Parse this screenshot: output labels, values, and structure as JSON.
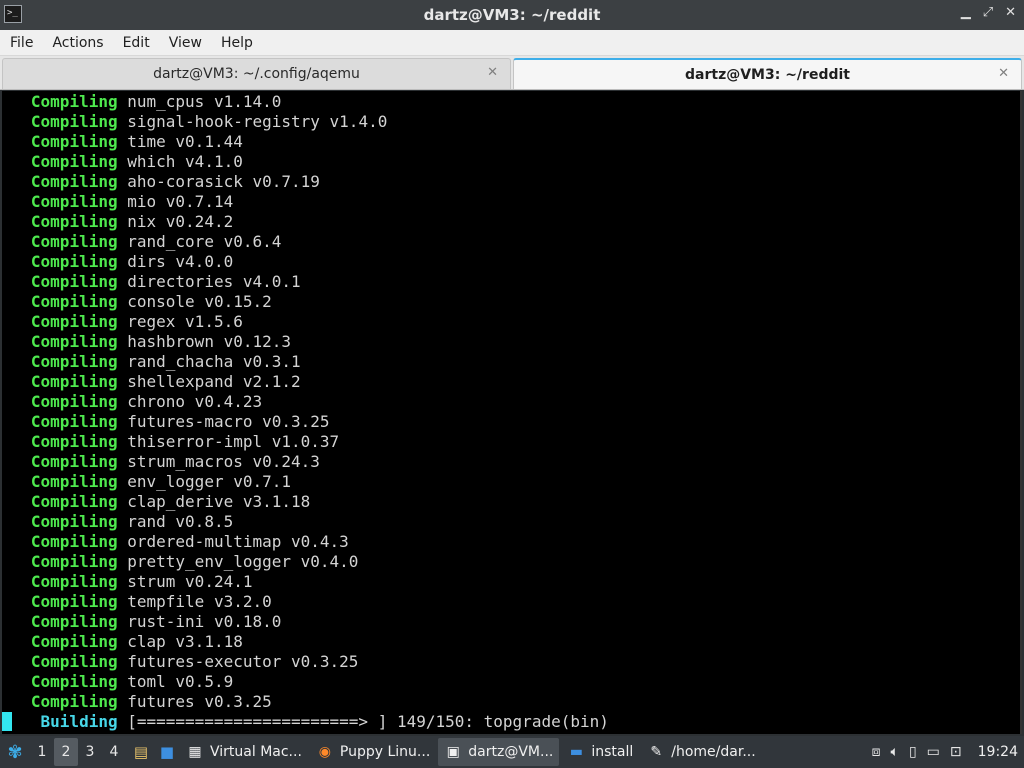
{
  "window": {
    "title": "dartz@VM3: ~/reddit",
    "minimize_glyph": "▁",
    "maximize_glyph": "⤢",
    "close_glyph": "✕"
  },
  "menu": [
    "File",
    "Actions",
    "Edit",
    "View",
    "Help"
  ],
  "tabs": [
    {
      "label": "dartz@VM3: ~/.config/aqemu",
      "active": false
    },
    {
      "label": "dartz@VM3: ~/reddit",
      "active": true
    }
  ],
  "terminal": {
    "lines": [
      {
        "verb": "Compiling",
        "text": "num_cpus v1.14.0"
      },
      {
        "verb": "Compiling",
        "text": "signal-hook-registry v1.4.0"
      },
      {
        "verb": "Compiling",
        "text": "time v0.1.44"
      },
      {
        "verb": "Compiling",
        "text": "which v4.1.0"
      },
      {
        "verb": "Compiling",
        "text": "aho-corasick v0.7.19"
      },
      {
        "verb": "Compiling",
        "text": "mio v0.7.14"
      },
      {
        "verb": "Compiling",
        "text": "nix v0.24.2"
      },
      {
        "verb": "Compiling",
        "text": "rand_core v0.6.4"
      },
      {
        "verb": "Compiling",
        "text": "dirs v4.0.0"
      },
      {
        "verb": "Compiling",
        "text": "directories v4.0.1"
      },
      {
        "verb": "Compiling",
        "text": "console v0.15.2"
      },
      {
        "verb": "Compiling",
        "text": "regex v1.5.6"
      },
      {
        "verb": "Compiling",
        "text": "hashbrown v0.12.3"
      },
      {
        "verb": "Compiling",
        "text": "rand_chacha v0.3.1"
      },
      {
        "verb": "Compiling",
        "text": "shellexpand v2.1.2"
      },
      {
        "verb": "Compiling",
        "text": "chrono v0.4.23"
      },
      {
        "verb": "Compiling",
        "text": "futures-macro v0.3.25"
      },
      {
        "verb": "Compiling",
        "text": "thiserror-impl v1.0.37"
      },
      {
        "verb": "Compiling",
        "text": "strum_macros v0.24.3"
      },
      {
        "verb": "Compiling",
        "text": "env_logger v0.7.1"
      },
      {
        "verb": "Compiling",
        "text": "clap_derive v3.1.18"
      },
      {
        "verb": "Compiling",
        "text": "rand v0.8.5"
      },
      {
        "verb": "Compiling",
        "text": "ordered-multimap v0.4.3"
      },
      {
        "verb": "Compiling",
        "text": "pretty_env_logger v0.4.0"
      },
      {
        "verb": "Compiling",
        "text": "strum v0.24.1"
      },
      {
        "verb": "Compiling",
        "text": "tempfile v3.2.0"
      },
      {
        "verb": "Compiling",
        "text": "rust-ini v0.18.0"
      },
      {
        "verb": "Compiling",
        "text": "clap v3.1.18"
      },
      {
        "verb": "Compiling",
        "text": "futures-executor v0.3.25"
      },
      {
        "verb": "Compiling",
        "text": "toml v0.5.9"
      },
      {
        "verb": "Compiling",
        "text": "futures v0.3.25"
      }
    ],
    "progress_line": {
      "verb": "Building",
      "text": "[=======================> ] 149/150: topgrade(bin)"
    }
  },
  "taskbar": {
    "desktops": [
      "1",
      "2",
      "3",
      "4"
    ],
    "active_desktop": 1,
    "tasks": [
      {
        "icon": "virtualbox-icon",
        "glyph": "▦",
        "label": "Virtual Mac..."
      },
      {
        "icon": "firefox-icon",
        "glyph": "◉",
        "label": "Puppy Linu..."
      },
      {
        "icon": "terminal-icon",
        "glyph": "▣",
        "label": "dartz@VM..."
      },
      {
        "icon": "folder-icon",
        "glyph": "▬",
        "label": "install"
      },
      {
        "icon": "text-editor-icon",
        "glyph": "✎",
        "label": "/home/dar..."
      }
    ],
    "clock": "19:24"
  }
}
